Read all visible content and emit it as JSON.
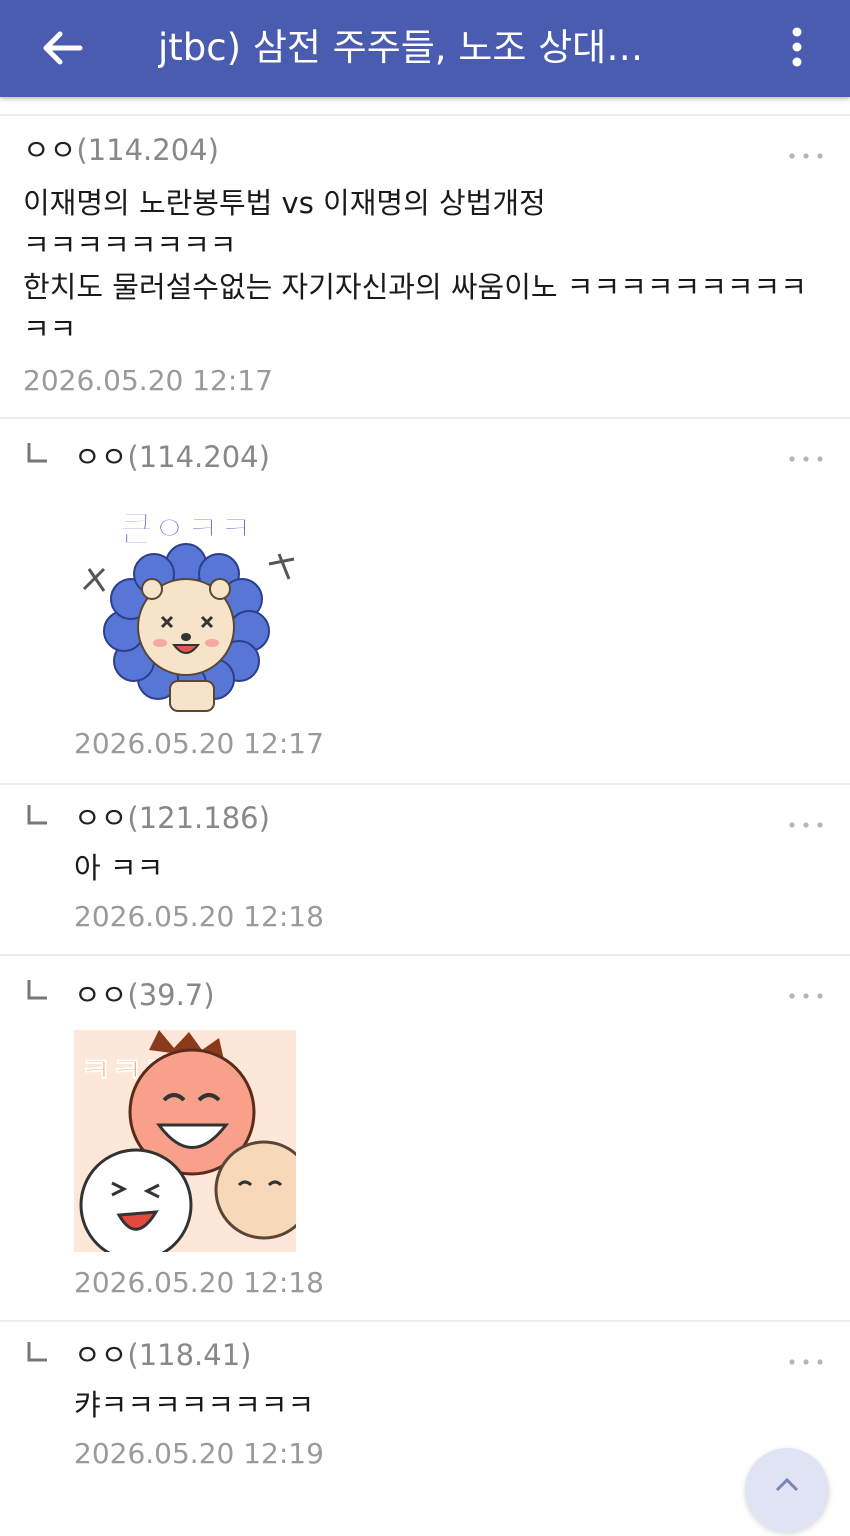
{
  "header": {
    "title": "jtbc) 삼전 주주들, 노조 상대…",
    "back_icon": "arrow-left-icon",
    "menu_icon": "more-vertical-icon",
    "color": "#4a5cb0"
  },
  "comments": [
    {
      "nick": "ㅇㅇ",
      "ip": "(114.204)",
      "lines": [
        "이재명의 노란봉투법 vs 이재명의 상법개정",
        "ㅋㅋㅋㅋㅋㅋㅋㅋ",
        "한치도 물러설수없는 자기자신과의 싸움이노 ㅋㅋㅋㅋㅋㅋㅋㅋㅋ",
        "ㅋㅋ"
      ],
      "date": "2026.05.20 12:17"
    },
    {
      "nick": "ㅇㅇ",
      "ip": "(114.204)",
      "sticker": "lion-sticker",
      "sticker_text": "큰ㅇㅋㅋ",
      "date": "2026.05.20 12:17"
    },
    {
      "nick": "ㅇㅇ",
      "ip": "(121.186)",
      "text": "아 ㅋㅋ",
      "date": "2026.05.20 12:18"
    },
    {
      "nick": "ㅇㅇ",
      "ip": "(39.7)",
      "sticker": "laughing-faces-sticker",
      "sticker_text": "ㅋㅋㅋ",
      "date": "2026.05.20 12:18"
    },
    {
      "nick": "ㅇㅇ",
      "ip": "(118.41)",
      "text": "캬ㅋㅋㅋㅋㅋㅋㅋㅋ",
      "date": "2026.05.20 12:19"
    }
  ],
  "icons": {
    "comment_menu": "more-horizontal-icon",
    "reply": "reply-corner-icon",
    "scroll_top": "chevron-up-icon"
  }
}
